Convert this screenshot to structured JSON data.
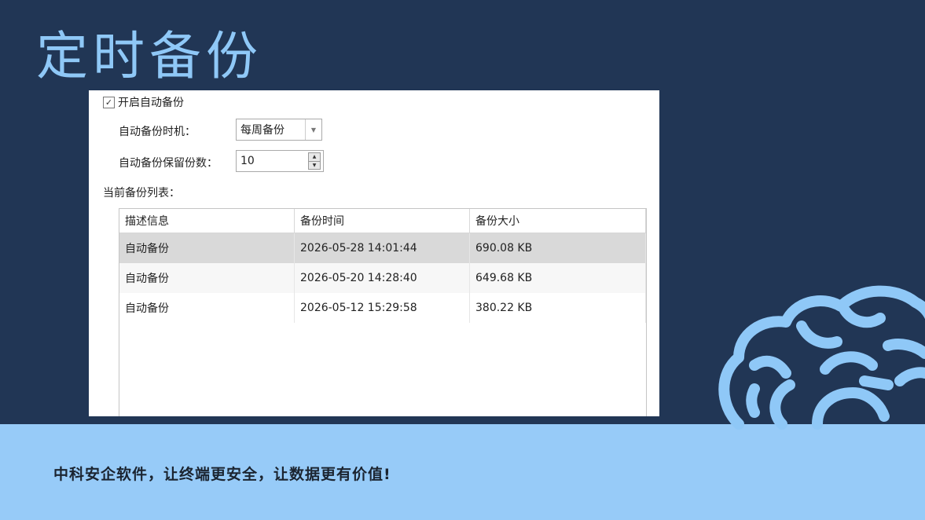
{
  "slide": {
    "title": "定时备份",
    "tagline": "中科安企软件，让终端更安全，让数据更有价值!"
  },
  "settings": {
    "enable_checked": true,
    "enable_label": "开启自动备份",
    "timing_label": "自动备份时机：",
    "timing_value": "每周备份",
    "retain_label": "自动备份保留份数：",
    "retain_value": "10",
    "list_label": "当前备份列表："
  },
  "table": {
    "columns": [
      "描述信息",
      "备份时间",
      "备份大小"
    ],
    "rows": [
      [
        "自动备份",
        "2026-05-28 14:01:44",
        "690.08 KB"
      ],
      [
        "自动备份",
        "2026-05-20 14:28:40",
        "649.68 KB"
      ],
      [
        "自动备份",
        "2026-05-12 15:29:58",
        "380.22 KB"
      ]
    ],
    "selected_row": 0
  },
  "colors": {
    "background": "#213655",
    "title": "#8fc8f7",
    "bottom_bar": "#97cbf8",
    "brain_icon": "#8fc8f7"
  },
  "icons": {
    "decoration": "brain-icon"
  }
}
